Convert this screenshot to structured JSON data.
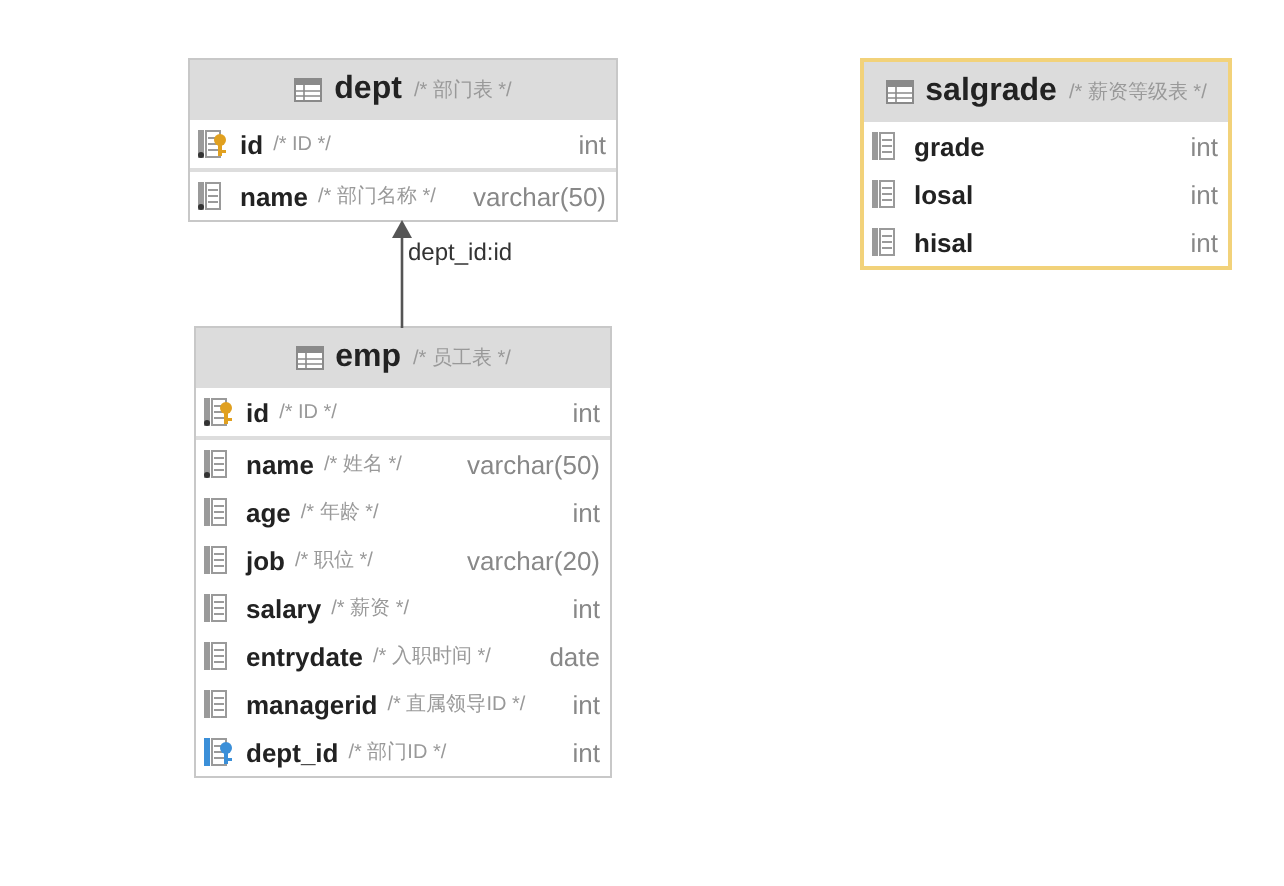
{
  "tables": [
    {
      "name": "dept",
      "comment": "/* 部门表 */",
      "selected": false,
      "columns": [
        {
          "kind": "pk",
          "name": "id",
          "comment": "/* ID */",
          "type": "int"
        },
        {
          "kind": "column",
          "not_null": true,
          "name": "name",
          "comment": "/* 部门名称 */",
          "type": "varchar(50)"
        }
      ]
    },
    {
      "name": "salgrade",
      "comment": "/* 薪资等级表 */",
      "selected": true,
      "columns": [
        {
          "kind": "column",
          "not_null": false,
          "name": "grade",
          "type": "int"
        },
        {
          "kind": "column",
          "not_null": false,
          "name": "losal",
          "type": "int"
        },
        {
          "kind": "column",
          "not_null": false,
          "name": "hisal",
          "type": "int"
        }
      ]
    },
    {
      "name": "emp",
      "comment": "/* 员工表 */",
      "selected": false,
      "columns": [
        {
          "kind": "pk",
          "name": "id",
          "comment": "/* ID */",
          "type": "int"
        },
        {
          "kind": "column",
          "not_null": true,
          "name": "name",
          "comment": "/* 姓名 */",
          "type": "varchar(50)"
        },
        {
          "kind": "column",
          "not_null": false,
          "name": "age",
          "comment": "/* 年龄 */",
          "type": "int"
        },
        {
          "kind": "column",
          "not_null": false,
          "name": "job",
          "comment": "/* 职位 */",
          "type": "varchar(20)"
        },
        {
          "kind": "column",
          "not_null": false,
          "name": "salary",
          "comment": "/* 薪资 */",
          "type": "int"
        },
        {
          "kind": "column",
          "not_null": false,
          "name": "entrydate",
          "comment": "/* 入职时间 */",
          "type": "date"
        },
        {
          "kind": "column",
          "not_null": false,
          "name": "managerid",
          "comment": "/* 直属领导ID */",
          "type": "int"
        },
        {
          "kind": "fk",
          "name": "dept_id",
          "comment": "/* 部门ID */",
          "type": "int"
        }
      ]
    }
  ],
  "relations": [
    {
      "label": "dept_id:id"
    }
  ]
}
